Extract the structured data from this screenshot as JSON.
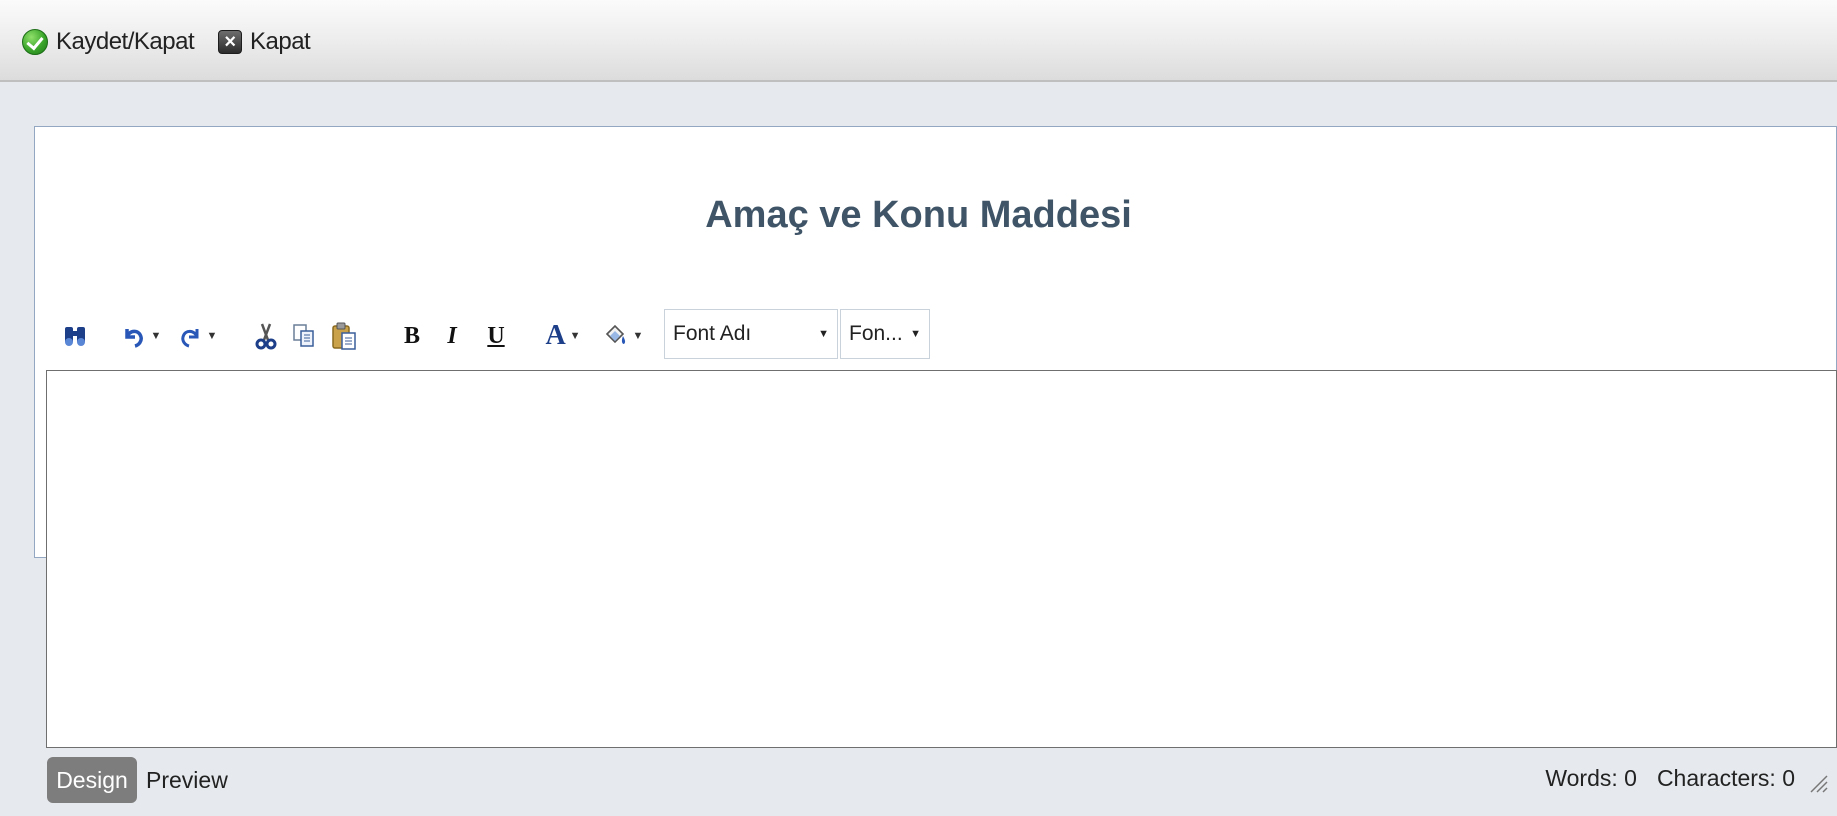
{
  "toolbar": {
    "save_close_label": "Kaydet/Kapat",
    "close_label": "Kapat"
  },
  "panel": {
    "title": "Amaç ve Konu Maddesi"
  },
  "editor_toolbar": {
    "icons": [
      "find-icon",
      "undo-icon",
      "redo-icon",
      "cut-icon",
      "copy-icon",
      "paste-icon",
      "bold-icon",
      "italic-icon",
      "underline-icon",
      "font-color-icon",
      "highlight-color-icon"
    ],
    "bold_glyph": "B",
    "italic_glyph": "I",
    "underline_glyph": "U",
    "font_color_glyph": "A",
    "font_name_value": "Font Adı",
    "font_size_value": "Fon..."
  },
  "editor": {
    "content": ""
  },
  "footer": {
    "design_label": "Design",
    "preview_label": "Preview",
    "words_label": "Words: 0",
    "characters_label": "Characters: 0"
  },
  "colors": {
    "title": "#3f5567",
    "page_bg": "#e6eaee",
    "panel_border": "#93a7c2",
    "design_tab_bg": "#7d7d7d"
  }
}
